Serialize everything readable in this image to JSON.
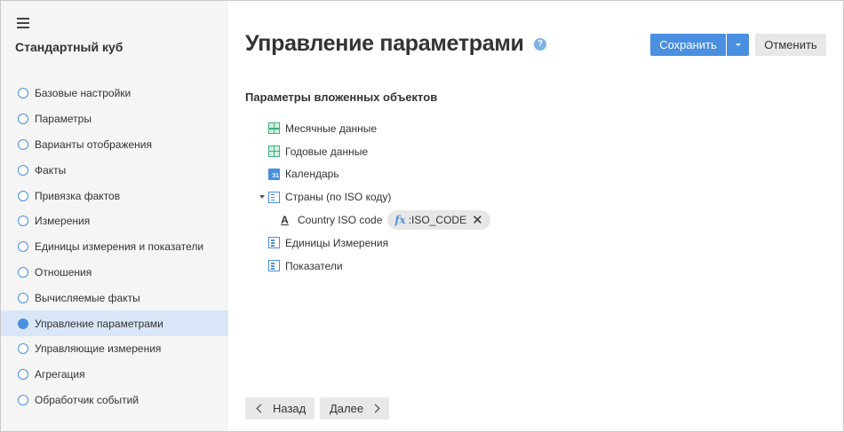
{
  "sidebar": {
    "app_title": "Стандартный куб",
    "items": [
      {
        "label": "Базовые настройки"
      },
      {
        "label": "Параметры"
      },
      {
        "label": "Варианты отображения"
      },
      {
        "label": "Факты"
      },
      {
        "label": "Привязка фактов"
      },
      {
        "label": "Измерения"
      },
      {
        "label": "Единицы измерения и показатели"
      },
      {
        "label": "Отношения"
      },
      {
        "label": "Вычисляемые факты"
      },
      {
        "label": "Управление параметрами",
        "active": true
      },
      {
        "label": "Управляющие измерения"
      },
      {
        "label": "Агрегация"
      },
      {
        "label": "Обработчик событий"
      }
    ]
  },
  "header": {
    "title": "Управление параметрами",
    "help_icon": "?",
    "save_label": "Сохранить",
    "cancel_label": "Отменить"
  },
  "main": {
    "section_title": "Параметры вложенных объектов",
    "tree": [
      {
        "label": "Месячные данные",
        "icon": "table-icon"
      },
      {
        "label": "Годовые данные",
        "icon": "table-icon"
      },
      {
        "label": "Календарь",
        "icon": "calendar-icon"
      },
      {
        "label": "Страны (по ISO коду)",
        "icon": "dictionary-icon",
        "expanded": true
      },
      {
        "label": "Country ISO code",
        "icon": "attribute-icon",
        "chip": ":ISO_CODE",
        "chip_prefix": "fx"
      },
      {
        "label": "Единицы Измерения",
        "icon": "dictionary-icon"
      },
      {
        "label": "Показатели",
        "icon": "dictionary-icon"
      }
    ]
  },
  "footer": {
    "back_label": "Назад",
    "next_label": "Далее"
  },
  "colors": {
    "accent": "#4a8fe0",
    "sidebar_bg": "#f5f5f5",
    "active_item_bg": "#d8e6f8",
    "table_icon": "#3fb27f"
  }
}
